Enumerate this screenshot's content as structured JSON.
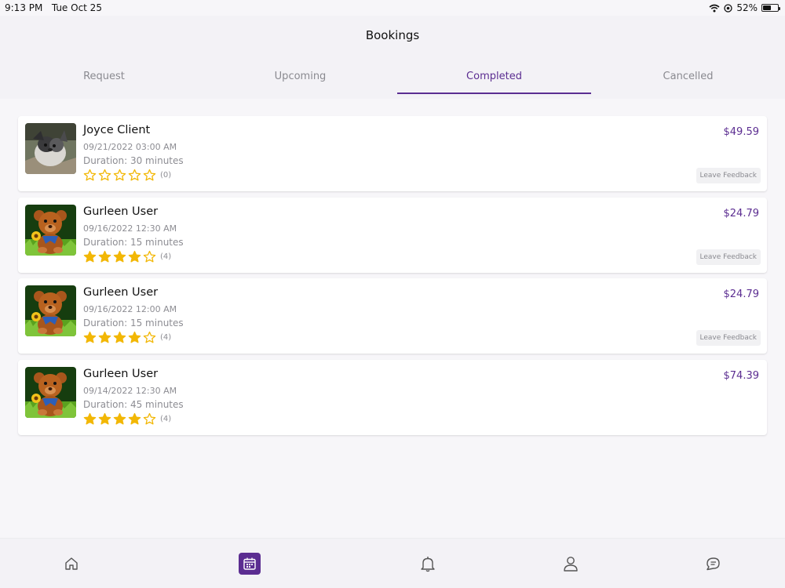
{
  "status_bar": {
    "time": "9:13 PM",
    "date": "Tue Oct 25",
    "battery": "52%",
    "battery_level": 0.52
  },
  "header": {
    "title": "Bookings"
  },
  "tabs": [
    {
      "label": "Request",
      "active": false
    },
    {
      "label": "Upcoming",
      "active": false
    },
    {
      "label": "Completed",
      "active": true
    },
    {
      "label": "Cancelled",
      "active": false
    }
  ],
  "bookings": [
    {
      "name": "Joyce Client",
      "date": "09/21/2022 03:00 AM",
      "duration": "Duration: 30 minutes",
      "rating": 0,
      "rating_count": "(0)",
      "price": "$49.59",
      "feedback_label": "Leave Feedback",
      "avatar": "dog-photo"
    },
    {
      "name": "Gurleen User",
      "date": "09/16/2022 12:30 AM",
      "duration": "Duration: 15 minutes",
      "rating": 4,
      "rating_count": "(4)",
      "price": "$24.79",
      "feedback_label": "Leave Feedback",
      "avatar": "teddy-bear-photo"
    },
    {
      "name": "Gurleen User",
      "date": "09/16/2022 12:00 AM",
      "duration": "Duration: 15 minutes",
      "rating": 4,
      "rating_count": "(4)",
      "price": "$24.79",
      "feedback_label": "Leave Feedback",
      "avatar": "teddy-bear-photo"
    },
    {
      "name": "Gurleen User",
      "date": "09/14/2022 12:30 AM",
      "duration": "Duration: 45 minutes",
      "rating": 4,
      "rating_count": "(4)",
      "price": "$74.39",
      "avatar": "teddy-bear-photo"
    }
  ],
  "bottom_nav": [
    {
      "icon": "home-icon",
      "active": false
    },
    {
      "icon": "calendar-icon",
      "active": true
    },
    {
      "icon": "bell-icon",
      "active": false
    },
    {
      "icon": "user-icon",
      "active": false
    },
    {
      "icon": "chat-icon",
      "active": false
    }
  ],
  "colors": {
    "accent": "#5b2d91",
    "star": "#f2b705",
    "muted": "#8d8d93"
  }
}
